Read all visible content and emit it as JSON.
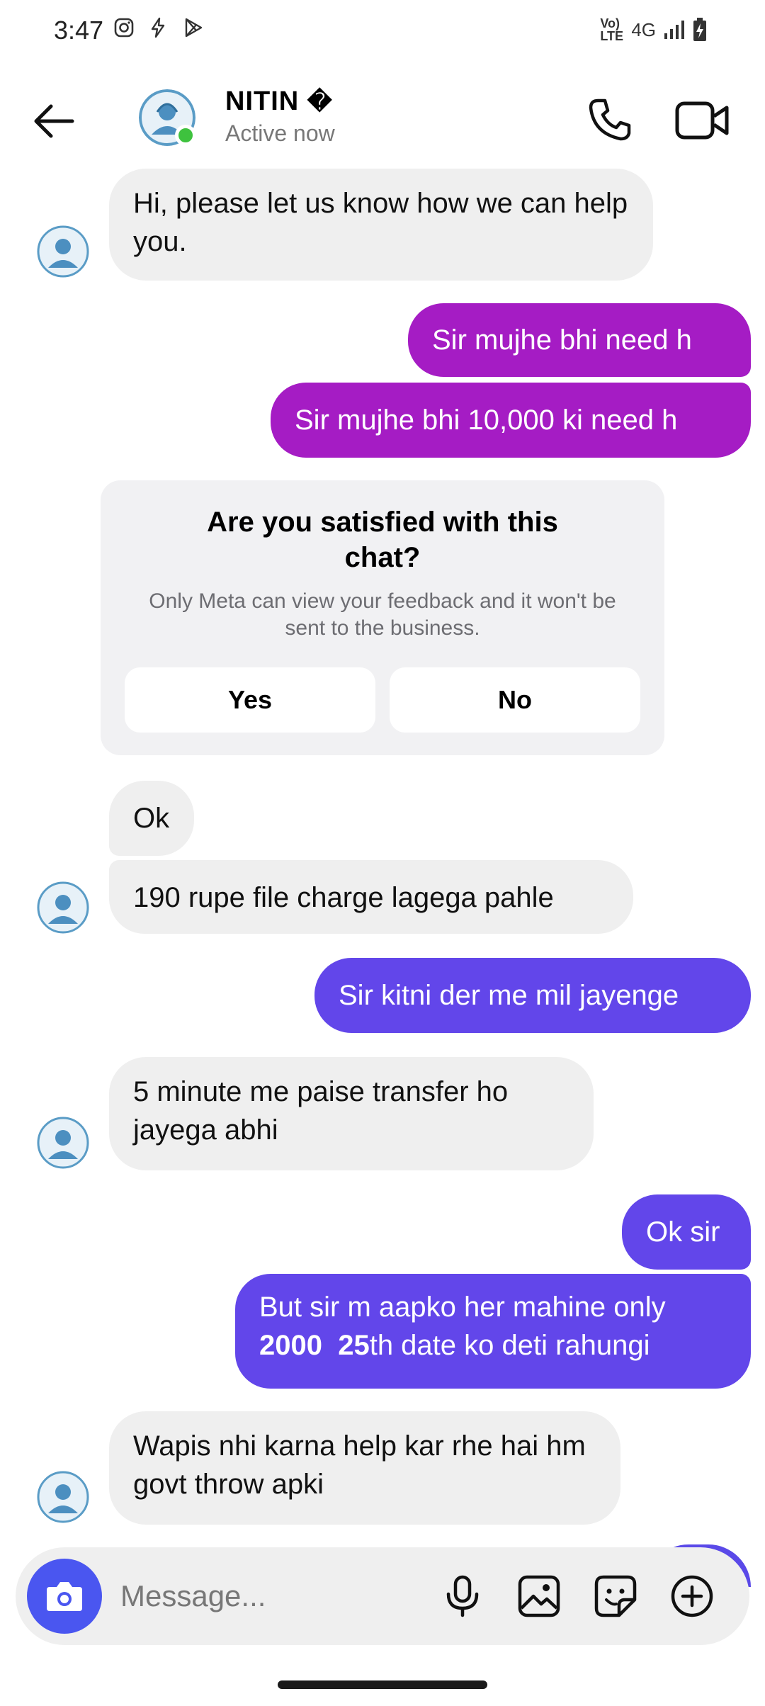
{
  "status_bar": {
    "time": "3:47",
    "network": "4G",
    "volte": "Vo) LTE"
  },
  "header": {
    "contact_name": "NITIN",
    "name_badge": "�",
    "presence": "Active now"
  },
  "messages": [
    {
      "from": "them",
      "text": "Hi, please let us know how we can help you."
    },
    {
      "from": "me",
      "text": "Sir mujhe bhi need h"
    },
    {
      "from": "me",
      "text": "Sir mujhe bhi 10,000 ki need h"
    },
    {
      "from": "them",
      "text": "Ok"
    },
    {
      "from": "them",
      "text": "190 rupe file charge lagega pahle"
    },
    {
      "from": "me",
      "text": "Sir kitni der me mil jayenge"
    },
    {
      "from": "them",
      "text": "5 minute me paise transfer ho jayega abhi"
    },
    {
      "from": "me",
      "text": "Ok sir"
    },
    {
      "from": "me",
      "text_parts": [
        "But sir m aapko her mahine only ",
        "2000  25",
        "th date ko deti rahungi"
      ]
    },
    {
      "from": "them",
      "text": "Wapis nhi karna help kar rhe hai hm govt throw apki"
    }
  ],
  "feedback": {
    "title": "Are you satisfied with this chat?",
    "subtitle": "Only Meta can view your feedback and it won't be sent to the business.",
    "yes_label": "Yes",
    "no_label": "No"
  },
  "composer": {
    "placeholder": "Message..."
  },
  "colors": {
    "outgoing_magenta": "#a51cc4",
    "outgoing_violet": "#6246ea",
    "incoming": "#efefef",
    "camera_button": "#4a56f0",
    "online": "#3ec23e"
  },
  "icons": [
    "back-arrow-icon",
    "phone-icon",
    "video-camera-icon",
    "camera-icon",
    "microphone-icon",
    "gallery-icon",
    "sticker-icon",
    "plus-icon"
  ]
}
